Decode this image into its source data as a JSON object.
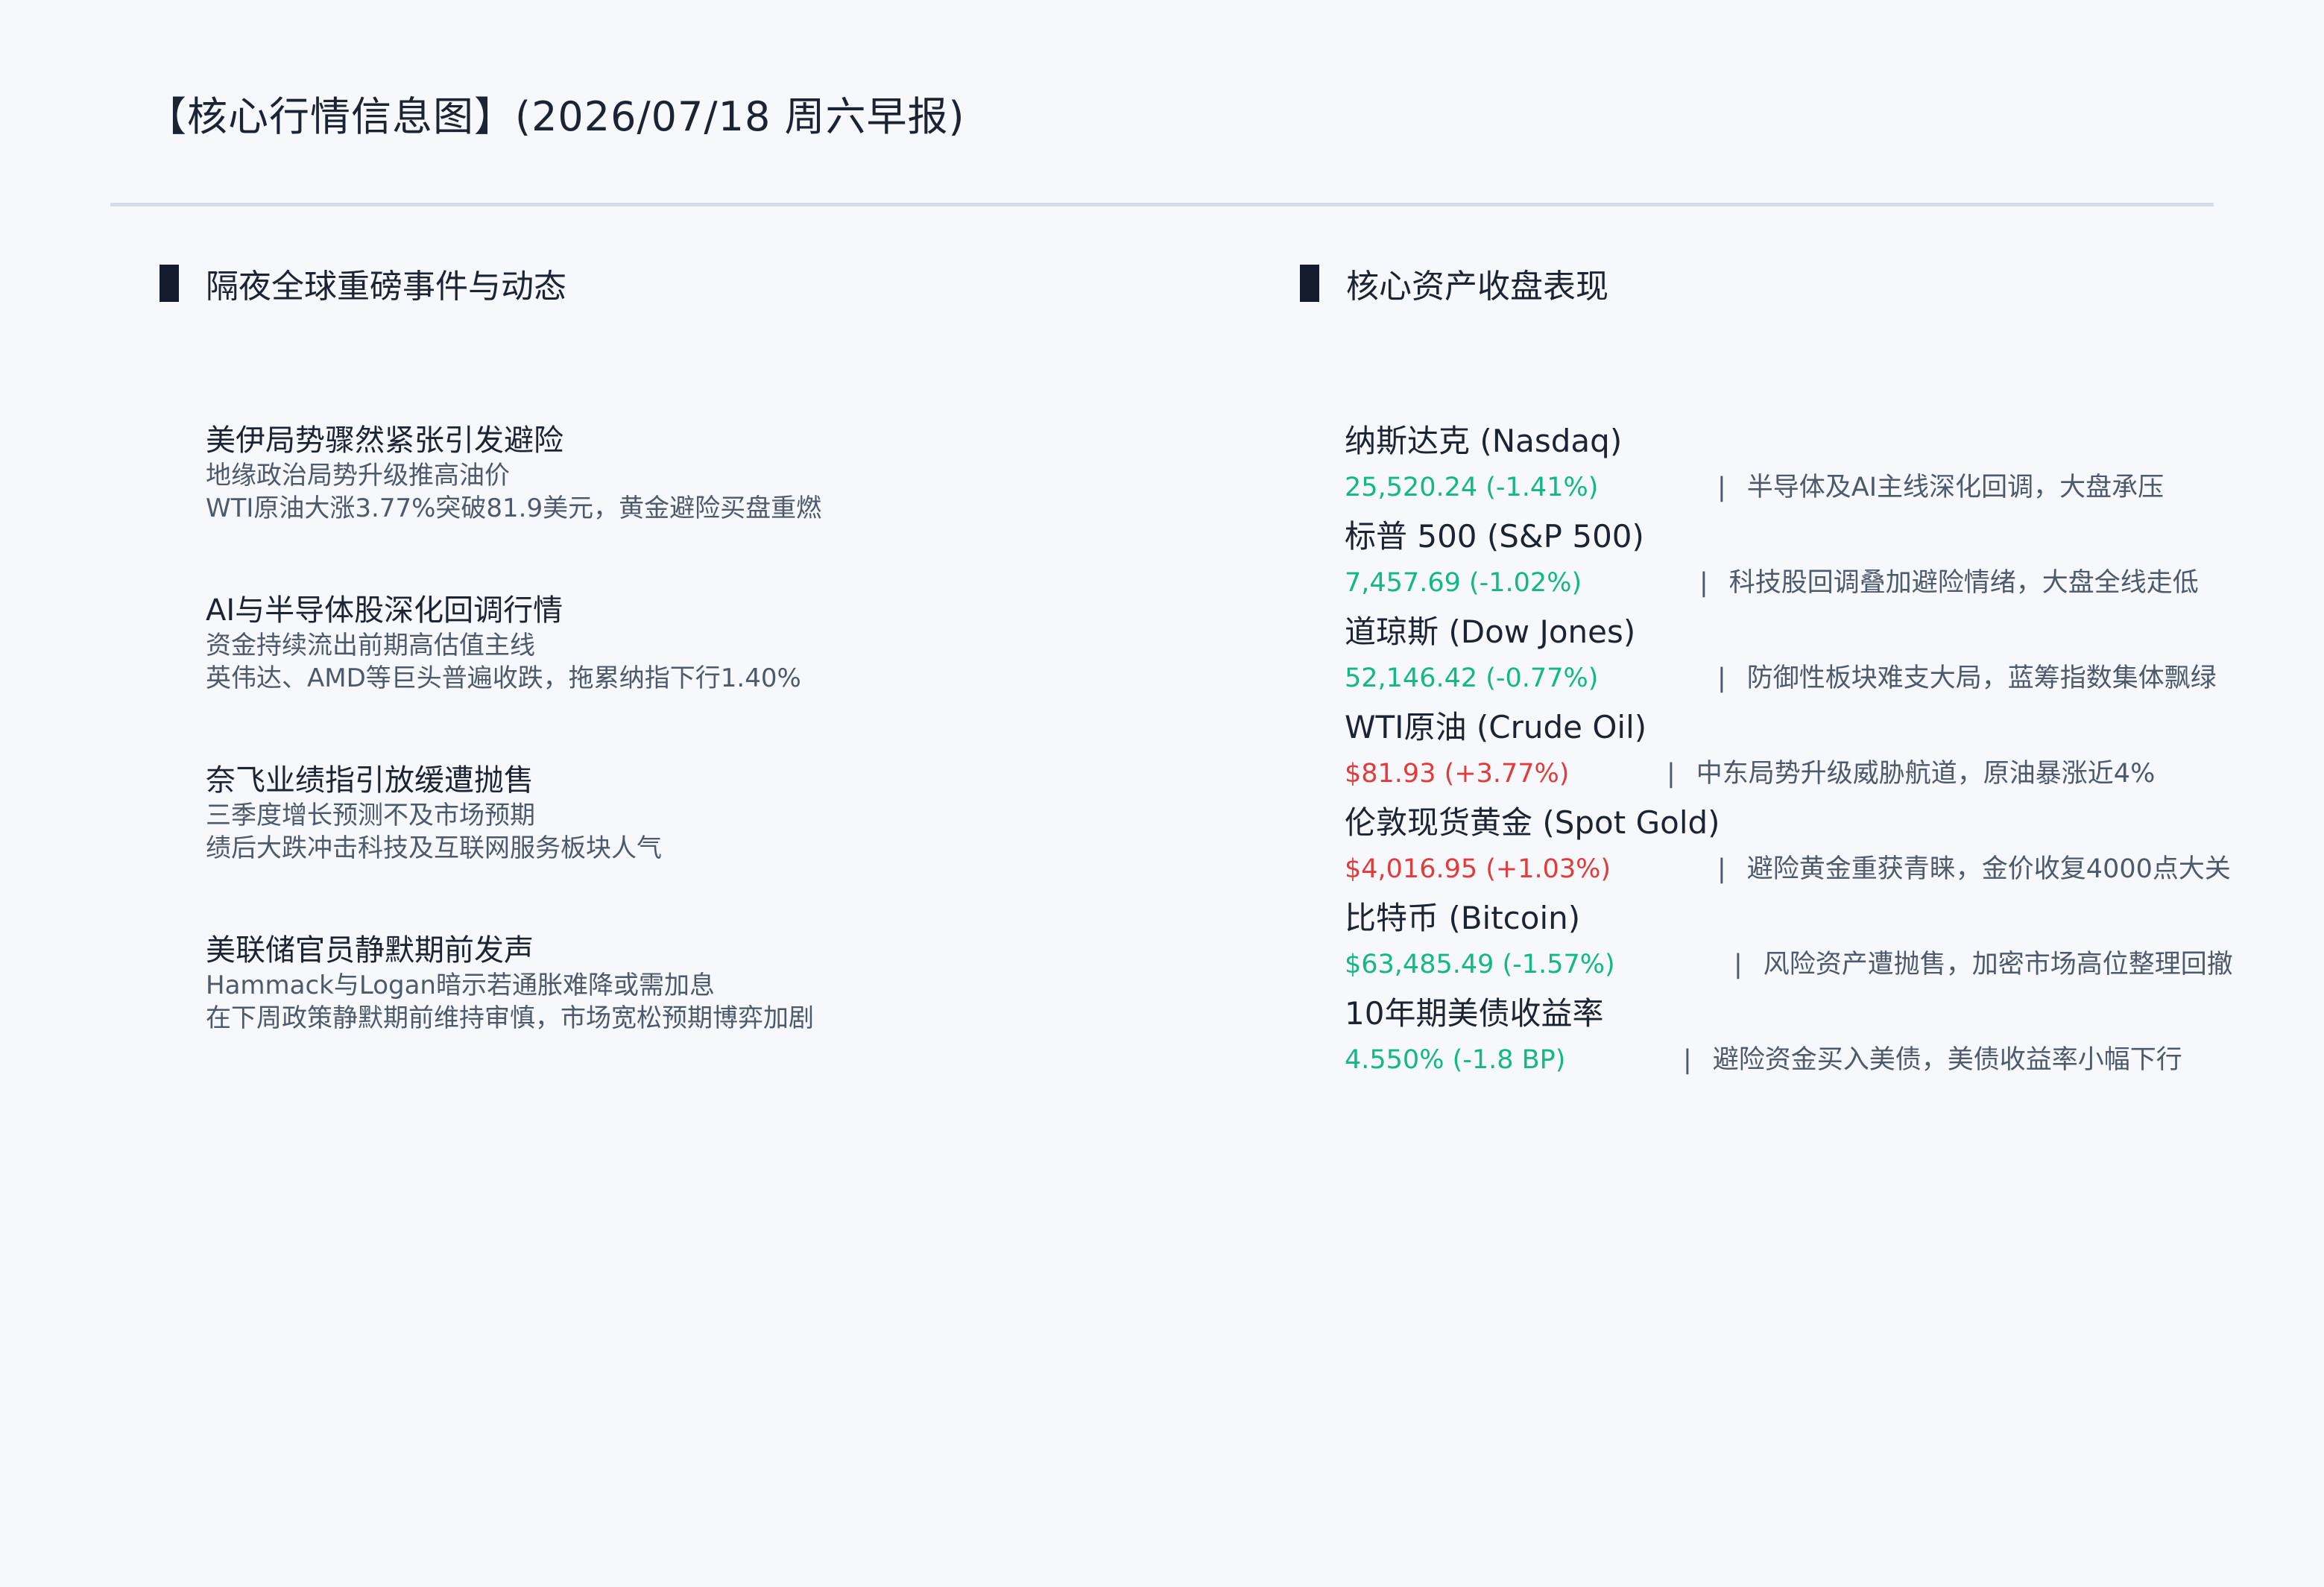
{
  "header": {
    "title": "【核心行情信息图】(2026/07/18 周六早报)"
  },
  "colors": {
    "up": "#e23b3b",
    "down": "#12b886",
    "accent_bar": "#141c2e",
    "rule": "#d6dde6"
  },
  "events_section": {
    "title": "隔夜全球重磅事件与动态",
    "items": [
      {
        "title": "美伊局势骤然紧张引发避险",
        "line1": "地缘政治局势升级推高油价",
        "line2": "WTI原油大涨3.77%突破81.9美元，黄金避险买盘重燃"
      },
      {
        "title": "AI与半导体股深化回调行情",
        "line1": "资金持续流出前期高估值主线",
        "line2": "英伟达、AMD等巨头普遍收跌，拖累纳指下行1.40%"
      },
      {
        "title": "奈飞业绩指引放缓遭抛售",
        "line1": "三季度增长预测不及市场预期",
        "line2": "绩后大跌冲击科技及互联网服务板块人气"
      },
      {
        "title": "美联储官员静默期前发声",
        "line1": "Hammack与Logan暗示若通胀难降或需加息",
        "line2": "在下周政策静默期前维持审慎，市场宽松预期博弈加剧"
      }
    ]
  },
  "assets_section": {
    "title": "核心资产收盘表现",
    "items": [
      {
        "name": "纳斯达克 (Nasdaq)",
        "value": "25,520.24 (-1.41%)",
        "direction": "down",
        "pipe": "|",
        "note": "半导体及AI主线深化回调，大盘承压"
      },
      {
        "name": "标普 500 (S&P 500)",
        "value": "7,457.69 (-1.02%)",
        "direction": "down",
        "pipe": "|",
        "note": "科技股回调叠加避险情绪，大盘全线走低"
      },
      {
        "name": "道琼斯 (Dow Jones)",
        "value": "52,146.42 (-0.77%)",
        "direction": "down",
        "pipe": "|",
        "note": "防御性板块难支大局，蓝筹指数集体飘绿"
      },
      {
        "name": "WTI原油 (Crude Oil)",
        "value": "$81.93 (+3.77%)",
        "direction": "up",
        "pipe": "|",
        "note": "中东局势升级威胁航道，原油暴涨近4%"
      },
      {
        "name": "伦敦现货黄金 (Spot Gold)",
        "value": "$4,016.95 (+1.03%)",
        "direction": "up",
        "pipe": "|",
        "note": "避险黄金重获青睐，金价收复4000点大关"
      },
      {
        "name": "比特币 (Bitcoin)",
        "value": "$63,485.49 (-1.57%)",
        "direction": "down",
        "pipe": "|",
        "note": "风险资产遭抛售，加密市场高位整理回撤"
      },
      {
        "name": "10年期美债收益率",
        "value": "4.550% (-1.8 BP)",
        "direction": "down",
        "pipe": "|",
        "note": "避险资金买入美债，美债收益率小幅下行"
      }
    ]
  }
}
